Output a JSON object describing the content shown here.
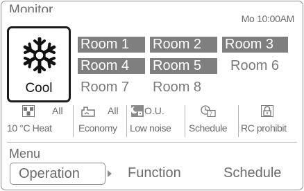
{
  "header": {
    "title": "Monitor",
    "datetime": "Mo 10:00AM"
  },
  "mode": {
    "label": "Cool",
    "icon": "snowflake-icon"
  },
  "rooms": [
    {
      "label": "Room 1",
      "active": true
    },
    {
      "label": "Room 2",
      "active": true
    },
    {
      "label": "Room 3",
      "active": true
    },
    {
      "label": "Room 4",
      "active": true
    },
    {
      "label": "Room 5",
      "active": true
    },
    {
      "label": "Room 6",
      "active": false
    },
    {
      "label": "Room 7",
      "active": false
    },
    {
      "label": "Room 8",
      "active": false
    }
  ],
  "functions": [
    {
      "icon": "heat-10c-icon",
      "value": "All",
      "label": "10 °C Heat"
    },
    {
      "icon": "economy-icon",
      "value": "All",
      "label": "Economy"
    },
    {
      "icon": "low-noise-icon",
      "value": "O.U.",
      "label": "Low noise"
    },
    {
      "icon": "schedule-icon",
      "value": "",
      "label": "Schedule"
    },
    {
      "icon": "lock-icon",
      "value": "",
      "label": "RC prohibit"
    }
  ],
  "menu": {
    "title": "Menu",
    "tabs": [
      {
        "label": "Operation",
        "selected": true
      },
      {
        "label": "Function",
        "selected": false
      },
      {
        "label": "Schedule",
        "selected": false
      }
    ]
  },
  "colors": {
    "active_room_bg": "#7f7f7f",
    "active_room_text": "#ffffff",
    "text_gray": "#6a6a6a",
    "mode_border": "#1a1a1a"
  }
}
